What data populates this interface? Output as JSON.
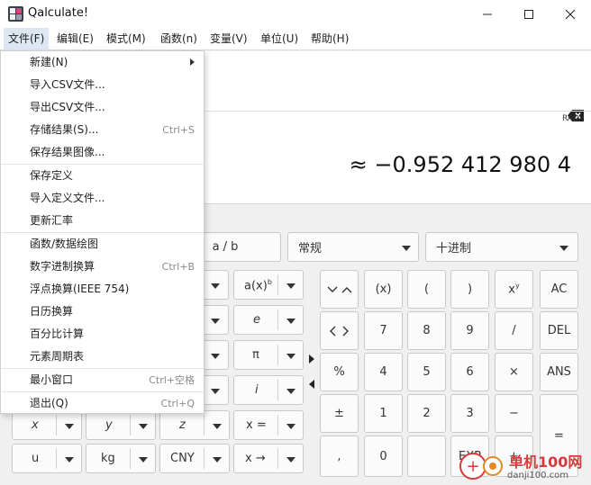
{
  "window": {
    "title": "Qalculate!"
  },
  "menubar": [
    "文件(F)",
    "编辑(E)",
    "模式(M)",
    "函数(n)",
    "变量(V)",
    "单位(U)",
    "帮助(H)"
  ],
  "file_menu": [
    {
      "label": "新建(N)",
      "accel": ""
    },
    {
      "label": "导入CSV文件...",
      "accel": ""
    },
    {
      "label": "导出CSV文件...",
      "accel": ""
    },
    {
      "label": "存储结果(S)...",
      "accel": "Ctrl+S"
    },
    {
      "label": "保存结果图像...",
      "accel": ""
    },
    {
      "label": "保存定义",
      "accel": ""
    },
    {
      "label": "导入定义文件...",
      "accel": ""
    },
    {
      "label": "更新汇率",
      "accel": ""
    },
    {
      "label": "函数/数据绘图",
      "accel": ""
    },
    {
      "label": "数字进制换算",
      "accel": "Ctrl+B"
    },
    {
      "label": "浮点换算(IEEE 754)",
      "accel": ""
    },
    {
      "label": "日历换算",
      "accel": ""
    },
    {
      "label": "百分比计算",
      "accel": ""
    },
    {
      "label": "元素周期表",
      "accel": ""
    },
    {
      "label": "最小窗口",
      "accel": "Ctrl+空格"
    },
    {
      "label": "退出(Q)",
      "accel": "Ctrl+Q"
    }
  ],
  "display": {
    "angle_mode": "RAD",
    "result": "≈ −0.952 412 980 4"
  },
  "toolbar": {
    "fraction_label": "a / b",
    "format_label": "常规",
    "base_label": "十进制"
  },
  "function_keys": {
    "power_base": "a(x)",
    "power_exp": "b",
    "e": "e",
    "pi": "π",
    "i": "i",
    "x": "x",
    "y": "y",
    "z": "z",
    "x_assign": "x =",
    "u": "u",
    "kg": "kg",
    "cny": "CNY",
    "x_to": "x →"
  },
  "numpad": {
    "paren_x": "(x)",
    "lparen": "(",
    "rparen": ")",
    "xy_base": "x",
    "xy_exp": "y",
    "ac": "AC",
    "n7": "7",
    "n8": "8",
    "n9": "9",
    "divide": "/",
    "del": "DEL",
    "percent": "%",
    "n4": "4",
    "n5": "5",
    "n6": "6",
    "times": "×",
    "ans": "ANS",
    "plusminus": "±",
    "n1": "1",
    "n2": "2",
    "n3": "3",
    "minus": "−",
    "equals": "=",
    "comma": ",",
    "n0": "0",
    "exp": "EXP",
    "plus": "+"
  },
  "watermark": {
    "title": "单机100网",
    "url": "danji100.com"
  },
  "colors": {
    "menu_active": "#dde7f2",
    "watermark": "#d9393b"
  }
}
